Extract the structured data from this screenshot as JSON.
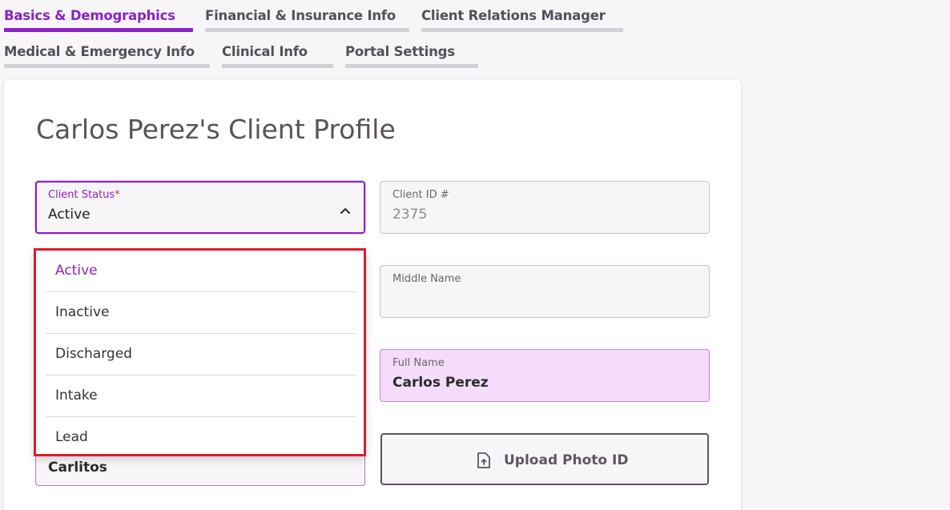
{
  "tabs": [
    {
      "label": "Basics & Demographics",
      "active": true
    },
    {
      "label": "Financial & Insurance Info"
    },
    {
      "label": "Client Relations Manager"
    },
    {
      "label": "Medical & Emergency Info"
    },
    {
      "label": "Clinical Info"
    },
    {
      "label": "Portal Settings"
    }
  ],
  "profile": {
    "title": "Carlos Perez's Client Profile"
  },
  "client_status": {
    "label": "Client Status",
    "required_mark": "*",
    "value": "Active",
    "options": [
      "Active",
      "Inactive",
      "Discharged",
      "Intake",
      "Lead"
    ]
  },
  "client_id": {
    "label": "Client ID #",
    "value": "2375"
  },
  "middle_name": {
    "label": "Middle Name",
    "value": ""
  },
  "full_name": {
    "label": "Full Name",
    "value": "Carlos Perez"
  },
  "nickname": {
    "value": "Carlitos"
  },
  "upload": {
    "label": "Upload Photo ID"
  },
  "colors": {
    "accent": "#8a22c4",
    "highlight_border": "#e01b2d",
    "pink_field": "#f5dcfb"
  }
}
